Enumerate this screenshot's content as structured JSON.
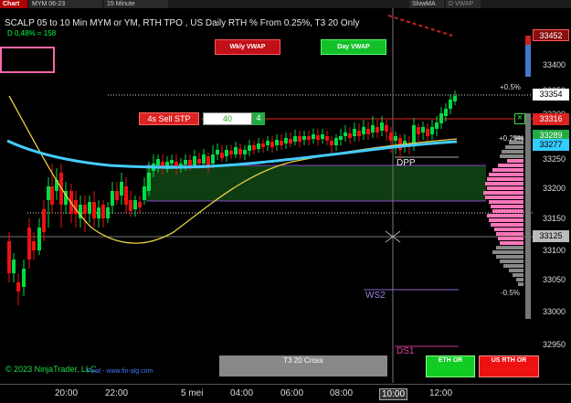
{
  "toolbar": {
    "chart_label": "Chart",
    "instrument": "MYM 06-23",
    "interval": "15 Minute",
    "indicator1": "SlowMA",
    "indicator2": "D VWAP"
  },
  "title": "SCALP 05 to 10 Min MYM or YM, RTH TPO , US Daily RTH % From 0.25%, T3 20 Only",
  "subtitle": "D 0,48% = 158",
  "buttons": {
    "wkly_vwap": "Wkly VWAP",
    "day_vwap": "Day VWAP",
    "t3_cross": "T3 20 Cross",
    "eth_or": "ETH OR",
    "rth_or": "US RTH OR"
  },
  "order": {
    "label": "4s Sell STP",
    "qty": "40",
    "count": "4"
  },
  "levels": {
    "pct_pos_05": "+0.5%",
    "pct_pos_025": "+0.25%",
    "pct_neg_05": "-0.5%",
    "dpp": "DPP",
    "ws2": "WS2",
    "ds1": "DS1"
  },
  "price_boxes": {
    "p1": "33452",
    "p2": "33354",
    "p3": "33316",
    "p4": "33289",
    "p5": "33277",
    "p6": "33125"
  },
  "y_axis": [
    "33400",
    "33350",
    "33300",
    "33250",
    "33200",
    "33150",
    "33100",
    "33050",
    "33000",
    "32950"
  ],
  "x_axis": [
    "20:00",
    "22:00",
    "5 mei",
    "04:00",
    "06:00",
    "08:00",
    "10:00",
    "12:00"
  ],
  "copyright": "© 2023 NinjaTrader, LLC",
  "watermark": "Final - www.fin-alg.com",
  "colors": {
    "up_candle": "#00dd44",
    "down_candle": "#ee1111",
    "ma_cyan": "#44ccff",
    "ma_yellow": "#e6d040",
    "sell_line": "#dd2222",
    "value_area": "#0e3d12",
    "profile": "#ff77bb"
  }
}
